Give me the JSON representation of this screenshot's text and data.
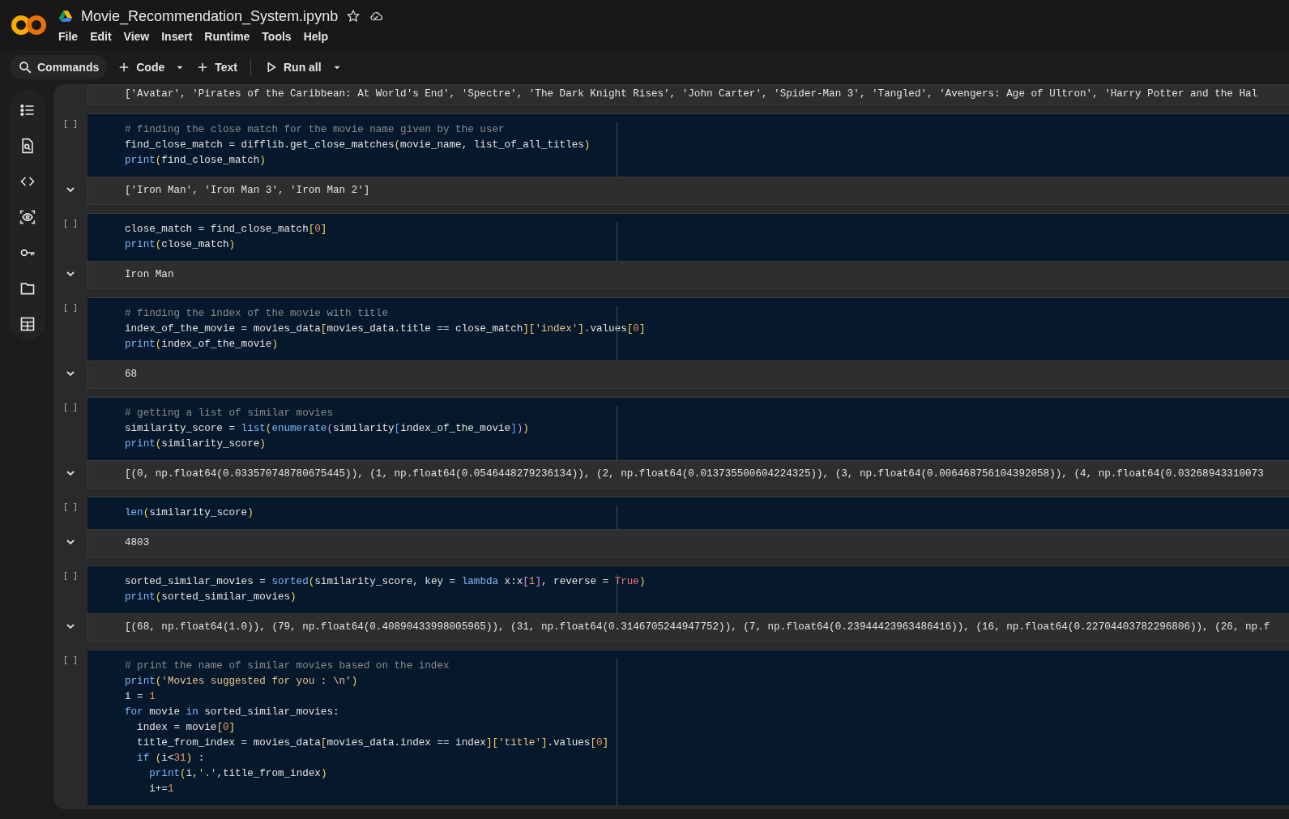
{
  "title": "Movie_Recommendation_System.ipynb",
  "menu": [
    "File",
    "Edit",
    "View",
    "Insert",
    "Runtime",
    "Tools",
    "Help"
  ],
  "toolbar": {
    "commands": "Commands",
    "code": "Code",
    "text": "Text",
    "run_all": "Run all"
  },
  "cells": [
    {
      "output": [
        "['Avatar', 'Pirates of the Caribbean: At World's End', 'Spectre', 'The Dark Knight Rises', 'John Carter', 'Spider-Man 3', 'Tangled', 'Avengers: Age of Ultron', 'Harry Potter and the Hal"
      ]
    },
    {
      "run": "[ ]",
      "code": [
        [
          {
            "text": "# finding the close match for the movie name given by the user",
            "kind": "comment"
          }
        ],
        [
          {
            "text": "find_close_match = difflib.get_close_matches"
          },
          {
            "text": "(",
            "kind": "bracket"
          },
          {
            "text": "movie_name, list_of_all_titles"
          },
          {
            "text": ")",
            "kind": "bracket"
          }
        ],
        [
          {
            "text": "print",
            "kind": "builtin"
          },
          {
            "text": "(",
            "kind": "bracket"
          },
          {
            "text": "find_close_match"
          },
          {
            "text": ")",
            "kind": "bracket"
          }
        ]
      ],
      "output": [
        "['Iron Man', 'Iron Man 3', 'Iron Man 2']"
      ]
    },
    {
      "run": "[ ]",
      "code": [
        [
          {
            "text": "close_match = find_close_match"
          },
          {
            "text": "[",
            "kind": "bracket"
          },
          {
            "text": "0",
            "kind": "number"
          },
          {
            "text": "]",
            "kind": "bracket"
          }
        ],
        [
          {
            "text": "print",
            "kind": "builtin"
          },
          {
            "text": "(",
            "kind": "bracket"
          },
          {
            "text": "close_match"
          },
          {
            "text": ")",
            "kind": "bracket"
          }
        ]
      ],
      "output": [
        "Iron Man"
      ]
    },
    {
      "run": "[ ]",
      "code": [
        [
          {
            "text": "# finding the index of the movie with title",
            "kind": "comment"
          }
        ],
        [
          {
            "text": "index_of_the_movie = movies_data"
          },
          {
            "text": "[",
            "kind": "bracket"
          },
          {
            "text": "movies_data.title == close_match"
          },
          {
            "text": "]",
            "kind": "bracket"
          },
          {
            "text": "[",
            "kind": "bracket"
          },
          {
            "text": "'index'",
            "kind": "string"
          },
          {
            "text": "]",
            "kind": "bracket"
          },
          {
            "text": ".values"
          },
          {
            "text": "[",
            "kind": "bracket"
          },
          {
            "text": "0",
            "kind": "number"
          },
          {
            "text": "]",
            "kind": "bracket"
          }
        ],
        [
          {
            "text": "print",
            "kind": "builtin"
          },
          {
            "text": "(",
            "kind": "bracket"
          },
          {
            "text": "index_of_the_movie"
          },
          {
            "text": ")",
            "kind": "bracket"
          }
        ]
      ],
      "output": [
        "68"
      ]
    },
    {
      "run": "[ ]",
      "code": [
        [
          {
            "text": "# getting a list of similar movies",
            "kind": "comment"
          }
        ],
        [
          {
            "text": "similarity_score = "
          },
          {
            "text": "list",
            "kind": "builtin"
          },
          {
            "text": "(",
            "kind": "bracket"
          },
          {
            "text": "enumerate",
            "kind": "builtin"
          },
          {
            "text": "(",
            "kind": "bracket2"
          },
          {
            "text": "similarity"
          },
          {
            "text": "[",
            "kind": "bracket3"
          },
          {
            "text": "index_of_the_movie"
          },
          {
            "text": "]",
            "kind": "bracket3"
          },
          {
            "text": ")",
            "kind": "bracket2"
          },
          {
            "text": ")",
            "kind": "bracket"
          }
        ],
        [
          {
            "text": "print",
            "kind": "builtin"
          },
          {
            "text": "(",
            "kind": "bracket"
          },
          {
            "text": "similarity_score"
          },
          {
            "text": ")",
            "kind": "bracket"
          }
        ]
      ],
      "output": [
        "[(0, np.float64(0.033570748780675445)), (1, np.float64(0.0546448279236134)), (2, np.float64(0.013735500604224325)), (3, np.float64(0.006468756104392058)), (4, np.float64(0.03268943310073"
      ]
    },
    {
      "run": "[ ]",
      "code": [
        [
          {
            "text": "len",
            "kind": "builtin"
          },
          {
            "text": "(",
            "kind": "bracket"
          },
          {
            "text": "similarity_score"
          },
          {
            "text": ")",
            "kind": "bracket"
          }
        ]
      ],
      "output": [
        "4803"
      ]
    },
    {
      "run": "[ ]",
      "code": [
        [
          {
            "text": "sorted_similar_movies = "
          },
          {
            "text": "sorted",
            "kind": "builtin"
          },
          {
            "text": "(",
            "kind": "bracket"
          },
          {
            "text": "similarity_score, key = "
          },
          {
            "text": "lambda",
            "kind": "keyword"
          },
          {
            "text": " x:x"
          },
          {
            "text": "[",
            "kind": "bracket2"
          },
          {
            "text": "1",
            "kind": "number"
          },
          {
            "text": "]",
            "kind": "bracket2"
          },
          {
            "text": ", reverse = "
          },
          {
            "text": "True",
            "kind": "constant"
          },
          {
            "text": ")",
            "kind": "bracket"
          }
        ],
        [
          {
            "text": "print",
            "kind": "builtin"
          },
          {
            "text": "(",
            "kind": "bracket"
          },
          {
            "text": "sorted_similar_movies"
          },
          {
            "text": ")",
            "kind": "bracket"
          }
        ]
      ],
      "output": [
        "[(68, np.float64(1.0)), (79, np.float64(0.40890433998005965)), (31, np.float64(0.3146705244947752)), (7, np.float64(0.23944423963486416)), (16, np.float64(0.22704403782296806)), (26, np.f"
      ]
    },
    {
      "run": "[ ]",
      "code": [
        [
          {
            "text": "# print the name of similar movies based on the index",
            "kind": "comment"
          }
        ],
        [
          {
            "text": "print",
            "kind": "builtin"
          },
          {
            "text": "(",
            "kind": "bracket"
          },
          {
            "text": "'Movies suggested for you : \\n'",
            "kind": "string"
          },
          {
            "text": ")",
            "kind": "bracket"
          }
        ],
        [
          {
            "text": "i = "
          },
          {
            "text": "1",
            "kind": "number"
          }
        ],
        [
          {
            "text": "for",
            "kind": "keyword"
          },
          {
            "text": " movie "
          },
          {
            "text": "in",
            "kind": "keyword"
          },
          {
            "text": " sorted_similar_movies:"
          }
        ],
        [
          {
            "text": "  index = movie"
          },
          {
            "text": "[",
            "kind": "bracket"
          },
          {
            "text": "0",
            "kind": "number"
          },
          {
            "text": "]",
            "kind": "bracket"
          }
        ],
        [
          {
            "text": "  title_from_index = movies_data"
          },
          {
            "text": "[",
            "kind": "bracket"
          },
          {
            "text": "movies_data.index == index"
          },
          {
            "text": "]",
            "kind": "bracket"
          },
          {
            "text": "[",
            "kind": "bracket"
          },
          {
            "text": "'title'",
            "kind": "string"
          },
          {
            "text": "]",
            "kind": "bracket"
          },
          {
            "text": ".values"
          },
          {
            "text": "[",
            "kind": "bracket"
          },
          {
            "text": "0",
            "kind": "number"
          },
          {
            "text": "]",
            "kind": "bracket"
          }
        ],
        [
          {
            "text": "  if",
            "kind": "keyword"
          },
          {
            "text": " (",
            "kind": "bracket"
          },
          {
            "text": "i<"
          },
          {
            "text": "31",
            "kind": "number"
          },
          {
            "text": ")",
            "kind": "bracket"
          },
          {
            "text": " :"
          }
        ],
        [
          {
            "text": "    print",
            "kind": "builtin"
          },
          {
            "text": "(",
            "kind": "bracket"
          },
          {
            "text": "i,"
          },
          {
            "text": "'.'",
            "kind": "string"
          },
          {
            "text": ",title_from_index"
          },
          {
            "text": ")",
            "kind": "bracket"
          }
        ],
        [
          {
            "text": "    i+="
          },
          {
            "text": "1",
            "kind": "number"
          }
        ]
      ]
    }
  ]
}
